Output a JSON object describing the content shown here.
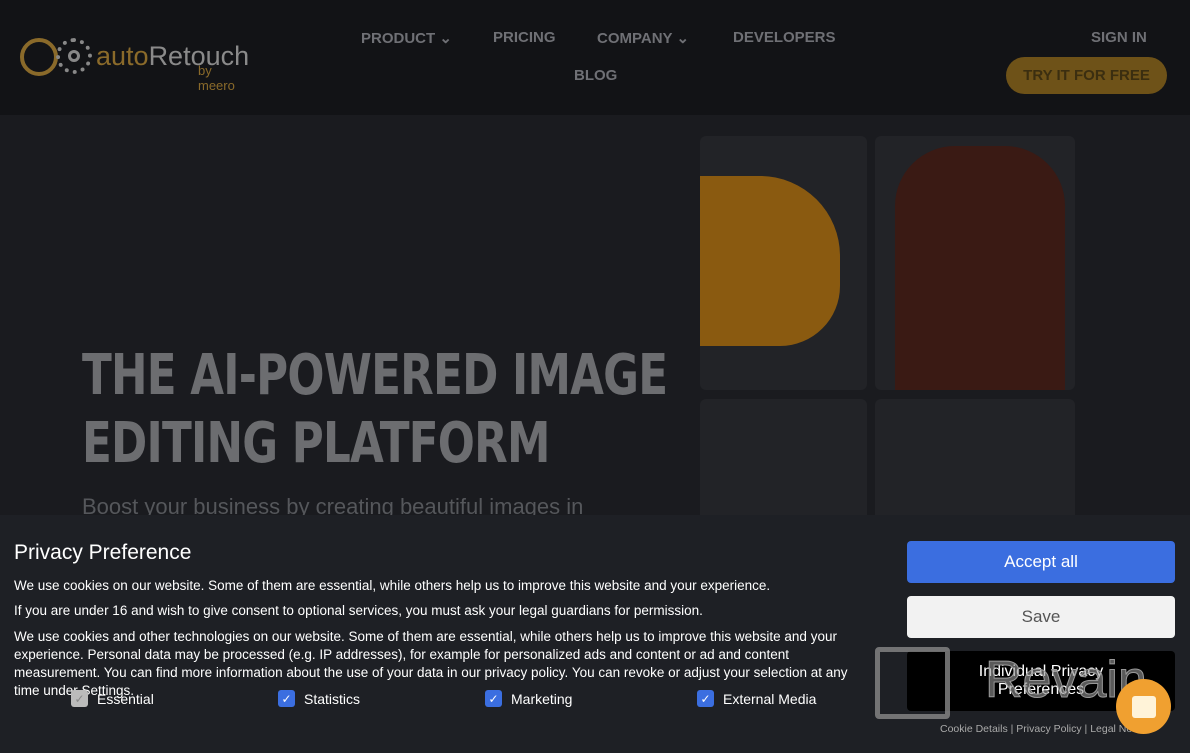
{
  "logo": {
    "auto": "auto",
    "retouch": "Retouch",
    "by": "by meero"
  },
  "nav": {
    "product": "PRODUCT",
    "pricing": "PRICING",
    "company": "COMPANY",
    "developers": "DEVELOPERS",
    "blog": "BLOG",
    "sign_in": "SIGN IN",
    "try": "TRY IT FOR FREE"
  },
  "hero": {
    "title_line1": "THE AI-POWERED IMAGE",
    "title_line2": "EDITING PLATFORM",
    "subtitle": "Boost your business by creating beautiful images in"
  },
  "privacy": {
    "title": "Privacy Preference",
    "p1": "We use cookies on our website. Some of them are essential, while others help us to improve this website and your experience.",
    "p2": "If you are under 16 and wish to give consent to optional services, you must ask your legal guardians for permission.",
    "p3": "We use cookies and other technologies on our website. Some of them are essential, while others help us to improve this website and your experience. Personal data may be processed (e.g. IP addresses), for example for personalized ads and content or ad and content measurement. You can find more information about the use of your data in our privacy policy. You can revoke or adjust your selection at any time under Settings.",
    "options": [
      {
        "label": "Essential",
        "checked": true,
        "disabled": true
      },
      {
        "label": "Statistics",
        "checked": true
      },
      {
        "label": "Marketing",
        "checked": true
      },
      {
        "label": "External Media",
        "checked": true
      }
    ],
    "accept": "Accept all",
    "save": "Save",
    "individual": "Individual Privacy Preferences",
    "links": [
      "Cookie Details",
      "Privacy Policy",
      "Legal Notice"
    ],
    "accent": "#3b6ee0"
  },
  "watermark": "Revain"
}
